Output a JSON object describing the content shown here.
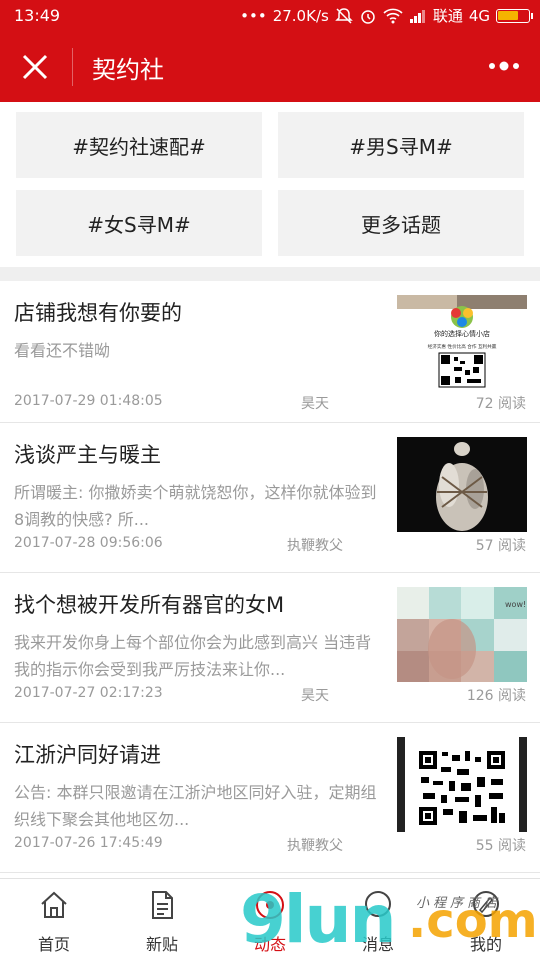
{
  "status_bar": {
    "time": "13:49",
    "dots": "•••",
    "speed": "27.0K/s",
    "carrier": "联通",
    "network": "4G"
  },
  "header": {
    "title": "契约社",
    "accent_color": "#d40f14"
  },
  "topics": [
    {
      "label": "#契约社速配#"
    },
    {
      "label": "#男S寻M#"
    },
    {
      "label": "#女S寻M#"
    },
    {
      "label": "更多话题"
    }
  ],
  "articles": [
    {
      "title": "店铺我想有你要的",
      "desc": "看看还不错呦",
      "date": "2017-07-29 01:48:05",
      "author": "昊天",
      "views": "72 阅读",
      "thumb_text": "你的选择心情小店",
      "thumb_tags": "经济实惠  性价比高  合作  互利共赢"
    },
    {
      "title": "浅谈严主与暖主",
      "desc": "所谓暖主: 你撒娇卖个萌就饶恕你，这样你就体验到8调教的快感? 所...",
      "date": "2017-07-28 09:56:06",
      "author": "执鞭教父",
      "views": "57 阅读"
    },
    {
      "title": "找个想被开发所有器官的女M",
      "desc": "我来开发你身上每个部位你会为此感到高兴 当违背我的指示你会受到我严厉技法来让你...",
      "date": "2017-07-27 02:17:23",
      "author": "昊天",
      "views": "126 阅读",
      "thumb_text": "wow!"
    },
    {
      "title": "江浙沪同好请进",
      "desc": "公告: 本群只限邀请在江浙沪地区同好入驻，定期组织线下聚会其他地区勿...",
      "date": "2017-07-26 17:45:49",
      "author": "执鞭教父",
      "views": "55 阅读"
    }
  ],
  "bottom_nav": [
    {
      "label": "首页",
      "icon": "home-icon"
    },
    {
      "label": "新贴",
      "icon": "document-icon"
    },
    {
      "label": "动态",
      "icon": "activity-icon"
    },
    {
      "label": "消息",
      "icon": "message-icon"
    },
    {
      "label": "我的",
      "icon": "profile-icon"
    }
  ],
  "watermark": {
    "main": "9lun",
    "suffix": ".com",
    "small": "小程序商店"
  }
}
